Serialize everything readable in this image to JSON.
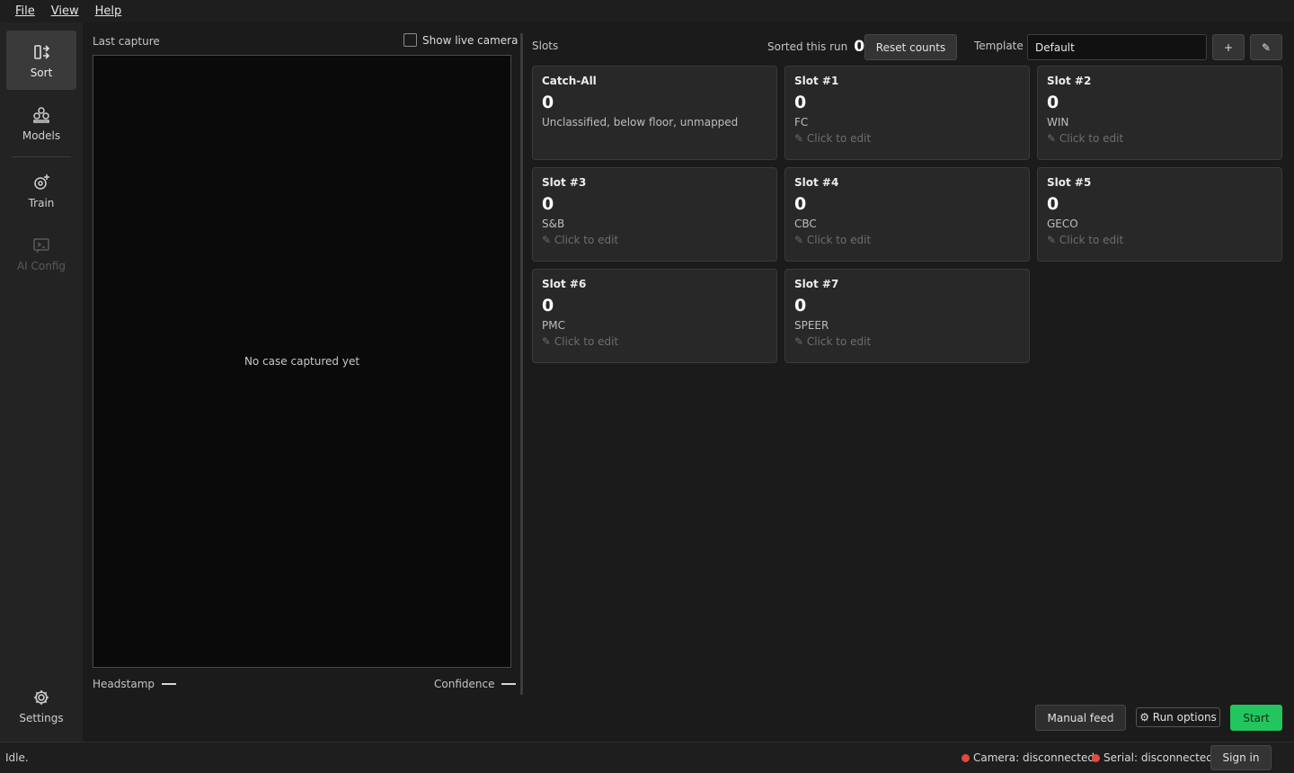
{
  "menu": {
    "file": "File",
    "view": "View",
    "help": "Help"
  },
  "sidebar": {
    "items": [
      {
        "label": "Sort",
        "icon": "sort-icon"
      },
      {
        "label": "Models",
        "icon": "models-icon"
      },
      {
        "label": "Train",
        "icon": "train-icon"
      },
      {
        "label": "AI Config",
        "icon": "ai-config-icon"
      }
    ],
    "settings_label": "Settings"
  },
  "capture": {
    "title": "Last capture",
    "show_live_camera": "Show live camera",
    "empty_message": "No case captured yet",
    "headstamp_label": "Headstamp",
    "confidence_label": "Confidence"
  },
  "slots_panel": {
    "title": "Slots",
    "sorted_label": "Sorted this run",
    "sorted_count": "0",
    "reset_label": "Reset counts",
    "template_label": "Template",
    "template_value": "Default",
    "add_label": "+",
    "edit_label": "✎"
  },
  "slots": [
    {
      "name": "Catch-All",
      "count": "0",
      "mapping": "Unclassified, below floor, unmapped",
      "edit": ""
    },
    {
      "name": "Slot #1",
      "count": "0",
      "mapping": "FC",
      "edit": "✎ Click to edit"
    },
    {
      "name": "Slot #2",
      "count": "0",
      "mapping": "WIN",
      "edit": "✎ Click to edit"
    },
    {
      "name": "Slot #3",
      "count": "0",
      "mapping": "S&B",
      "edit": "✎ Click to edit"
    },
    {
      "name": "Slot #4",
      "count": "0",
      "mapping": "CBC",
      "edit": "✎ Click to edit"
    },
    {
      "name": "Slot #5",
      "count": "0",
      "mapping": "GECO",
      "edit": "✎ Click to edit"
    },
    {
      "name": "Slot #6",
      "count": "0",
      "mapping": "PMC",
      "edit": "✎ Click to edit"
    },
    {
      "name": "Slot #7",
      "count": "0",
      "mapping": "SPEER",
      "edit": "✎ Click to edit"
    }
  ],
  "actions": {
    "manual_feed": "Manual feed",
    "run_options": "⚙ Run options",
    "start": "Start"
  },
  "status": {
    "text": "Idle.",
    "camera": "Camera: disconnected",
    "serial": "Serial: disconnected",
    "sign_in": "Sign in"
  },
  "colors": {
    "start_button": "#22c55e",
    "disconnected_dot": "#e5483f",
    "active_nav": "#3a3a3a"
  }
}
